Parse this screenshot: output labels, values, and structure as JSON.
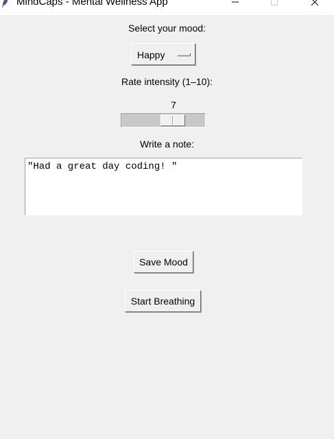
{
  "window": {
    "title": "MindCaps - Mental Wellness App"
  },
  "mood": {
    "label": "Select your mood:",
    "selected": "Happy",
    "options_visible": [
      "Happy"
    ]
  },
  "intensity": {
    "label": "Rate intensity (1–10):",
    "value": "7",
    "min": 1,
    "max": 10
  },
  "note": {
    "label": "Write a note:",
    "text": "\"Had a great day coding! \""
  },
  "buttons": {
    "save_label": "Save Mood",
    "breathing_label": "Start Breathing"
  },
  "icons": {
    "app": "feather-icon",
    "minimize": "minimize-icon",
    "maximize": "maximize-icon",
    "close": "close-icon"
  },
  "colors": {
    "window_bg": "#f0f0f0",
    "titlebar_bg": "#ffffff",
    "trough": "#c8c8c8",
    "text_area_bg": "#ffffff"
  }
}
